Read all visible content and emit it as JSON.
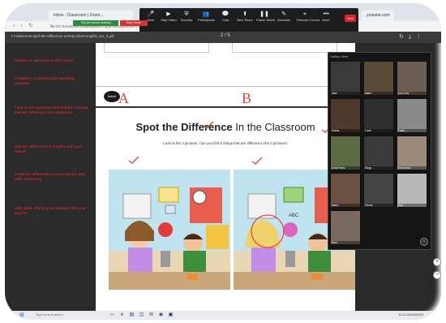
{
  "browser": {
    "tabs": [
      "Inbox - Classroom | Zoom...",
      "youtube.com"
    ],
    "url": "file:///C:/Users/Rich/Downloads/t-t-spot-the-difference-in-the-classroom"
  },
  "zoom_toolbar": {
    "items": [
      {
        "label": "Mute",
        "icon": "mic-icon"
      },
      {
        "label": "Stop Video",
        "icon": "video-icon"
      },
      {
        "label": "Security",
        "icon": "shield-icon"
      },
      {
        "label": "Participants",
        "icon": "people-icon",
        "count": "14"
      },
      {
        "label": "Chat",
        "icon": "chat-icon"
      },
      {
        "label": "New Share",
        "icon": "share-icon"
      },
      {
        "label": "Pause Share",
        "icon": "pause-icon"
      },
      {
        "label": "Annotate",
        "icon": "pen-icon"
      },
      {
        "label": "Remote Control",
        "icon": "remote-icon"
      },
      {
        "label": "More",
        "icon": "more-icon"
      }
    ],
    "end_label": "End",
    "share_status": "You are screen sharing",
    "stop_share": "Stop Share"
  },
  "pdf": {
    "title": "t-t-classroom-spot-the-difference-activity-sheet-english_ver_3.pdf",
    "page": "2 / 5"
  },
  "notes": [
    "Chapter 1: Welcome to the lesson",
    "Chapter 2: Listening and Speaking activities",
    "Look at the 2 pictures and find the 6 things that are different in the classroom",
    "Say the differences in English with your friends",
    "Circle the differences in each picture and write sentences",
    "Well done! Check your answers with your teacher"
  ],
  "worksheet": {
    "letter_a": "A",
    "letter_b": "B",
    "logo": "twinkl",
    "title_bold": "Spot the Difference",
    "title_rest": " In the Classroom",
    "instructions": "Look at the 2 pictures. Can you find 6 things that are different in the 2 pictures?",
    "clock_text": "ABC"
  },
  "gallery": {
    "header": "Gallery View",
    "participants": [
      "Jack",
      "Maria",
      "Ana Ortiz",
      "Carlos",
      "Lucia",
      "Pablo",
      "Sofia Perez",
      "Diego",
      "Elena Ruiz",
      "Marta",
      "Tomas",
      "Ines",
      "Raul"
    ]
  },
  "taskbar": {
    "search_placeholder": "Type here to search",
    "time": "11:24",
    "date": "24/04/2020"
  },
  "colors": {
    "annotation": "#e0453c",
    "notes_text": "#ff2a2a",
    "end_button": "#e0232b",
    "share_banner": "#2e8b3a"
  }
}
